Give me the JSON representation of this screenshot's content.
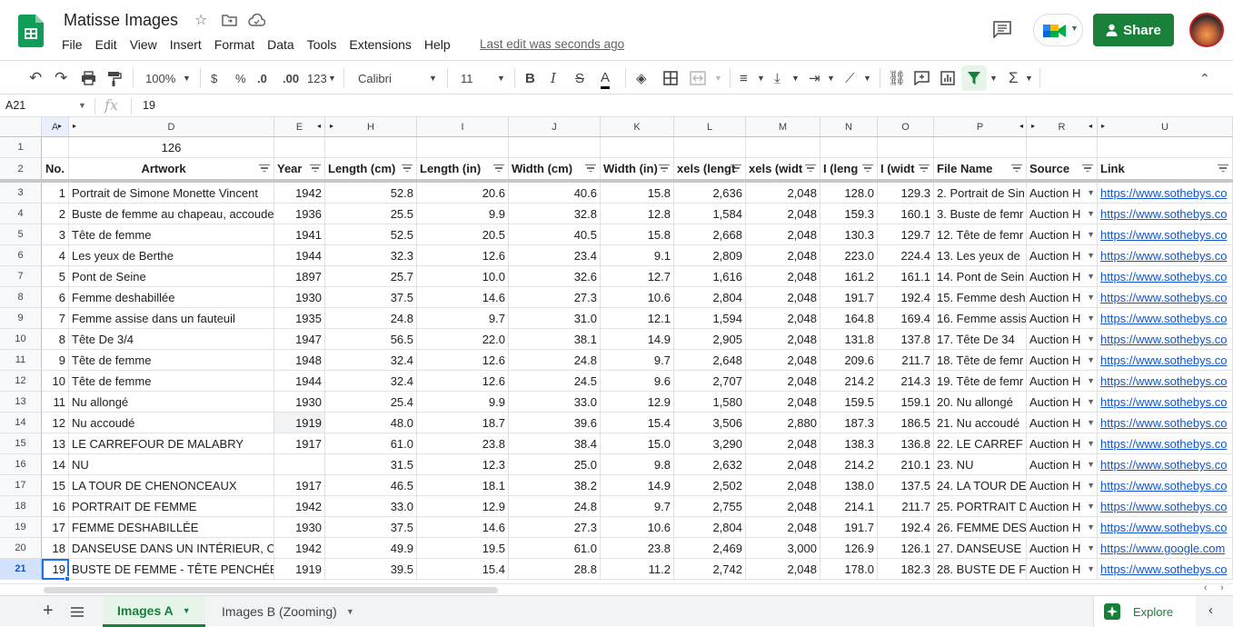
{
  "app": {
    "title": "Matisse Images",
    "menu": [
      "File",
      "Edit",
      "View",
      "Insert",
      "Format",
      "Data",
      "Tools",
      "Extensions",
      "Help"
    ],
    "last_edit": "Last edit was seconds ago",
    "share_label": "Share"
  },
  "toolbar": {
    "zoom": "100%",
    "currency": "$",
    "percent": "%",
    "dec_decrease": ".0",
    "dec_increase": ".00",
    "more_formats": "123",
    "font": "Calibri",
    "font_size": "11",
    "bold": "B",
    "italic": "I",
    "strike": "S",
    "text_color": "A"
  },
  "formula_bar": {
    "name_box": "A21",
    "fx": "fx",
    "value": "19"
  },
  "columns": [
    {
      "letter": "A",
      "selected": true
    },
    {
      "letter": "D"
    },
    {
      "letter": "E"
    },
    {
      "letter": "H"
    },
    {
      "letter": "I"
    },
    {
      "letter": "J"
    },
    {
      "letter": "K"
    },
    {
      "letter": "L"
    },
    {
      "letter": "M"
    },
    {
      "letter": "N"
    },
    {
      "letter": "O"
    },
    {
      "letter": "P"
    },
    {
      "letter": "R"
    },
    {
      "letter": "U"
    }
  ],
  "row1": {
    "number": "1",
    "d_value": "126"
  },
  "headers": {
    "number": "2",
    "cells": [
      "No.",
      "Artwork",
      "Year",
      "Length (cm)",
      "Length (in)",
      "Width (cm)",
      "Width (in)",
      "xels (lengt",
      "xels (widt",
      "I (leng",
      "I (widt",
      "File Name",
      "Source",
      "Link"
    ]
  },
  "rows": [
    {
      "row": "3",
      "no": "1",
      "artwork": "Portrait de Simone Monette Vincent",
      "year": "1942",
      "len_cm": "52.8",
      "len_in": "20.6",
      "wid_cm": "40.6",
      "wid_in": "15.8",
      "px_len": "2,636",
      "px_wid": "2,048",
      "ppi_len": "128.0",
      "ppi_wid": "129.3",
      "file": "2. Portrait de Sin",
      "source": "Auction H",
      "link": "https://www.sothebys.co"
    },
    {
      "row": "4",
      "no": "2",
      "artwork": "Buste de femme au chapeau, accoude",
      "year": "1936",
      "len_cm": "25.5",
      "len_in": "9.9",
      "wid_cm": "32.8",
      "wid_in": "12.8",
      "px_len": "1,584",
      "px_wid": "2,048",
      "ppi_len": "159.3",
      "ppi_wid": "160.1",
      "file": "3. Buste de femr",
      "source": "Auction H",
      "link": "https://www.sothebys.co"
    },
    {
      "row": "5",
      "no": "3",
      "artwork": "Tête de femme",
      "year": "1941",
      "len_cm": "52.5",
      "len_in": "20.5",
      "wid_cm": "40.5",
      "wid_in": "15.8",
      "px_len": "2,668",
      "px_wid": "2,048",
      "ppi_len": "130.3",
      "ppi_wid": "129.7",
      "file": "12. Tête de femr",
      "source": "Auction H",
      "link": "https://www.sothebys.co"
    },
    {
      "row": "6",
      "no": "4",
      "artwork": "Les yeux de Berthe",
      "year": "1944",
      "len_cm": "32.3",
      "len_in": "12.6",
      "wid_cm": "23.4",
      "wid_in": "9.1",
      "px_len": "2,809",
      "px_wid": "2,048",
      "ppi_len": "223.0",
      "ppi_wid": "224.4",
      "file": "13. Les yeux de",
      "source": "Auction H",
      "link": "https://www.sothebys.co"
    },
    {
      "row": "7",
      "no": "5",
      "artwork": "Pont de Seine",
      "year": "1897",
      "len_cm": "25.7",
      "len_in": "10.0",
      "wid_cm": "32.6",
      "wid_in": "12.7",
      "px_len": "1,616",
      "px_wid": "2,048",
      "ppi_len": "161.2",
      "ppi_wid": "161.1",
      "file": "14. Pont de Sein",
      "source": "Auction H",
      "link": "https://www.sothebys.co"
    },
    {
      "row": "8",
      "no": "6",
      "artwork": "Femme deshabillée",
      "year": "1930",
      "len_cm": "37.5",
      "len_in": "14.6",
      "wid_cm": "27.3",
      "wid_in": "10.6",
      "px_len": "2,804",
      "px_wid": "2,048",
      "ppi_len": "191.7",
      "ppi_wid": "192.4",
      "file": "15. Femme desh",
      "source": "Auction H",
      "link": "https://www.sothebys.co"
    },
    {
      "row": "9",
      "no": "7",
      "artwork": "Femme assise dans un fauteuil",
      "year": "1935",
      "len_cm": "24.8",
      "len_in": "9.7",
      "wid_cm": "31.0",
      "wid_in": "12.1",
      "px_len": "1,594",
      "px_wid": "2,048",
      "ppi_len": "164.8",
      "ppi_wid": "169.4",
      "file": "16. Femme assis",
      "source": "Auction H",
      "link": "https://www.sothebys.co"
    },
    {
      "row": "10",
      "no": "8",
      "artwork": "Tête De 3/4",
      "year": "1947",
      "len_cm": "56.5",
      "len_in": "22.0",
      "wid_cm": "38.1",
      "wid_in": "14.9",
      "px_len": "2,905",
      "px_wid": "2,048",
      "ppi_len": "131.8",
      "ppi_wid": "137.8",
      "file": "17. Tête De 34",
      "source": "Auction H",
      "link": "https://www.sothebys.co"
    },
    {
      "row": "11",
      "no": "9",
      "artwork": "Tête de femme",
      "year": "1948",
      "len_cm": "32.4",
      "len_in": "12.6",
      "wid_cm": "24.8",
      "wid_in": "9.7",
      "px_len": "2,648",
      "px_wid": "2,048",
      "ppi_len": "209.6",
      "ppi_wid": "211.7",
      "file": "18. Tête de femr",
      "source": "Auction H",
      "link": "https://www.sothebys.co"
    },
    {
      "row": "12",
      "no": "10",
      "artwork": "Tête de femme",
      "year": "1944",
      "len_cm": "32.4",
      "len_in": "12.6",
      "wid_cm": "24.5",
      "wid_in": "9.6",
      "px_len": "2,707",
      "px_wid": "2,048",
      "ppi_len": "214.2",
      "ppi_wid": "214.3",
      "file": "19. Tête de femr",
      "source": "Auction H",
      "link": "https://www.sothebys.co"
    },
    {
      "row": "13",
      "no": "11",
      "artwork": "Nu allongé",
      "year": "1930",
      "len_cm": "25.4",
      "len_in": "9.9",
      "wid_cm": "33.0",
      "wid_in": "12.9",
      "px_len": "1,580",
      "px_wid": "2,048",
      "ppi_len": "159.5",
      "ppi_wid": "159.1",
      "file": "20. Nu allongé",
      "source": "Auction H",
      "link": "https://www.sothebys.co"
    },
    {
      "row": "14",
      "no": "12",
      "artwork": "Nu accoudé",
      "year": "1919",
      "len_cm": "48.0",
      "len_in": "18.7",
      "wid_cm": "39.6",
      "wid_in": "15.4",
      "px_len": "3,506",
      "px_wid": "2,880",
      "ppi_len": "187.3",
      "ppi_wid": "186.5",
      "file": "21. Nu accoudé",
      "source": "Auction H",
      "link": "https://www.sothebys.co"
    },
    {
      "row": "15",
      "no": "13",
      "artwork": "LE CARREFOUR DE MALABRY",
      "year": "1917",
      "len_cm": "61.0",
      "len_in": "23.8",
      "wid_cm": "38.4",
      "wid_in": "15.0",
      "px_len": "3,290",
      "px_wid": "2,048",
      "ppi_len": "138.3",
      "ppi_wid": "136.8",
      "file": "22. LE CARREF",
      "source": "Auction H",
      "link": "https://www.sothebys.co"
    },
    {
      "row": "16",
      "no": "14",
      "artwork": "NU",
      "year": "",
      "len_cm": "31.5",
      "len_in": "12.3",
      "wid_cm": "25.0",
      "wid_in": "9.8",
      "px_len": "2,632",
      "px_wid": "2,048",
      "ppi_len": "214.2",
      "ppi_wid": "210.1",
      "file": "23. NU",
      "source": "Auction H",
      "link": "https://www.sothebys.co"
    },
    {
      "row": "17",
      "no": "15",
      "artwork": "LA TOUR DE CHENONCEAUX",
      "year": "1917",
      "len_cm": "46.5",
      "len_in": "18.1",
      "wid_cm": "38.2",
      "wid_in": "14.9",
      "px_len": "2,502",
      "px_wid": "2,048",
      "ppi_len": "138.0",
      "ppi_wid": "137.5",
      "file": "24. LA TOUR DE",
      "source": "Auction H",
      "link": "https://www.sothebys.co"
    },
    {
      "row": "18",
      "no": "16",
      "artwork": "PORTRAIT DE FEMME",
      "year": "1942",
      "len_cm": "33.0",
      "len_in": "12.9",
      "wid_cm": "24.8",
      "wid_in": "9.7",
      "px_len": "2,755",
      "px_wid": "2,048",
      "ppi_len": "214.1",
      "ppi_wid": "211.7",
      "file": "25. PORTRAIT D",
      "source": "Auction H",
      "link": "https://www.sothebys.co"
    },
    {
      "row": "19",
      "no": "17",
      "artwork": "FEMME DESHABILLÉE",
      "year": "1930",
      "len_cm": "37.5",
      "len_in": "14.6",
      "wid_cm": "27.3",
      "wid_in": "10.6",
      "px_len": "2,804",
      "px_wid": "2,048",
      "ppi_len": "191.7",
      "ppi_wid": "192.4",
      "file": "26. FEMME DES",
      "source": "Auction H",
      "link": "https://www.sothebys.co"
    },
    {
      "row": "20",
      "no": "18",
      "artwork": "DANSEUSE DANS UN INTÉRIEUR, CAR",
      "year": "1942",
      "len_cm": "49.9",
      "len_in": "19.5",
      "wid_cm": "61.0",
      "wid_in": "23.8",
      "px_len": "2,469",
      "px_wid": "3,000",
      "ppi_len": "126.9",
      "ppi_wid": "126.1",
      "file": "27. DANSEUSE",
      "source": "Auction H",
      "link": "https://www.google.com"
    },
    {
      "row": "21",
      "no": "19",
      "artwork": "BUSTE DE FEMME - TÊTE PENCHÉE À",
      "year": "1919",
      "len_cm": "39.5",
      "len_in": "15.4",
      "wid_cm": "28.8",
      "wid_in": "11.2",
      "px_len": "2,742",
      "px_wid": "2,048",
      "ppi_len": "178.0",
      "ppi_wid": "182.3",
      "file": "28. BUSTE DE F",
      "source": "Auction H",
      "link": "https://www.sothebys.co"
    }
  ],
  "sheets": {
    "add": "+",
    "tabs": [
      "Images A",
      "Images B (Zooming)"
    ],
    "active": "Images A",
    "explore": "Explore"
  },
  "colors": {
    "accent": "#188038",
    "link": "#1155cc",
    "selected_header": "#d3e3fd"
  }
}
